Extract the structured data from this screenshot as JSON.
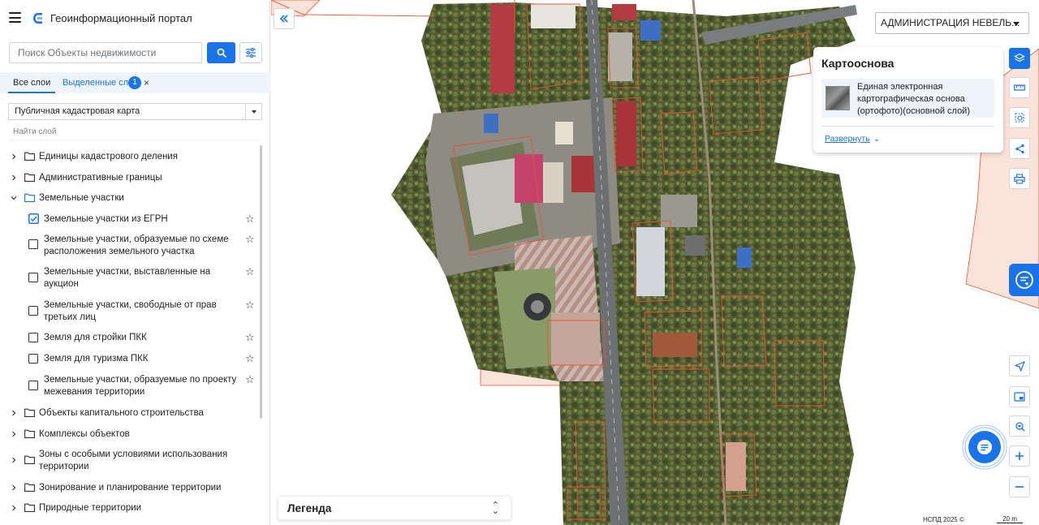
{
  "app": {
    "title": "Геоинформационный портал"
  },
  "search": {
    "placeholder": "Поиск Объекты недвижимости"
  },
  "tabs": {
    "all_label": "Все слои",
    "selected_label": "Выделенные слои",
    "selected_count": "1",
    "close": "×"
  },
  "layer_select": {
    "value": "Публичная кадастровая карта"
  },
  "find_layer": {
    "placeholder": "Найти слой"
  },
  "tree": {
    "groups": [
      {
        "label": "Единицы кадастрового деления",
        "expanded": false
      },
      {
        "label": "Административные границы",
        "expanded": false
      },
      {
        "label": "Земельные участки",
        "expanded": true
      }
    ],
    "sublayers": [
      {
        "label": "Земельные участки из ЕГРН",
        "checked": true
      },
      {
        "label": "Земельные участки, образуемые по схеме расположения земельного участка",
        "checked": false
      },
      {
        "label": "Земельные участки, выставленные на аукцион",
        "checked": false
      },
      {
        "label": "Земельные участки, свободные от прав третьих лиц",
        "checked": false
      },
      {
        "label": "Земля для стройки ПКК",
        "checked": false
      },
      {
        "label": "Земля для туризма ПКК",
        "checked": false
      },
      {
        "label": "Земельные участки, образуемые по проекту межевания территории",
        "checked": false
      }
    ],
    "groups_after": [
      {
        "label": "Объекты капитального строительства",
        "expanded": false
      },
      {
        "label": "Комплексы объектов",
        "expanded": false
      },
      {
        "label": "Зоны с особыми условиями использования территории",
        "expanded": false
      },
      {
        "label": "Зонирование и планирование территории",
        "expanded": false
      },
      {
        "label": "Природные территории",
        "expanded": false
      }
    ]
  },
  "legend": {
    "label": "Легенда"
  },
  "map": {
    "admin_select": "АДМИНИСТРАЦИЯ НЕВЕЛЬ...",
    "kartoosnova": {
      "title": "Картооснова",
      "item": "Единая электронная картографическая основа (ортофото)(основной слой)",
      "expand": "Развернуть"
    },
    "attribution": "НСПД 2025 ©",
    "scale": "20 m"
  },
  "colors": {
    "accent": "#1a73e8",
    "parcel_outline": "#e8552f",
    "parcel_fill": "#f7c9b8"
  }
}
